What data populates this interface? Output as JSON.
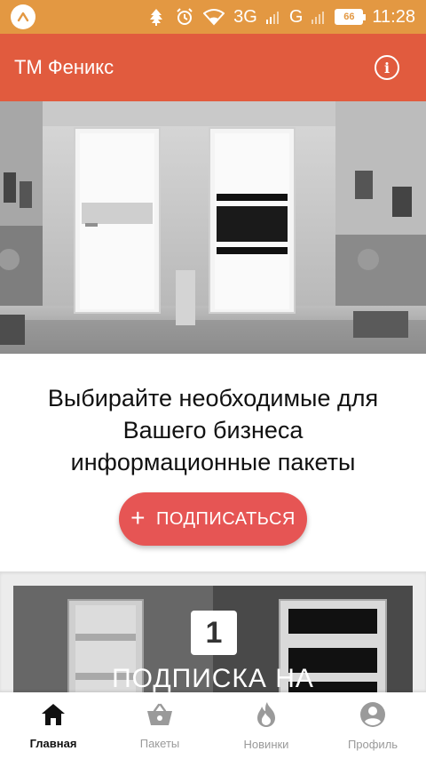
{
  "status_bar": {
    "network_3g": "3G",
    "network_g": "G",
    "battery": "66",
    "time": "11:28",
    "icons": [
      "app-badge-icon",
      "tree-icon",
      "alarm-icon",
      "wifi-icon",
      "signal-icon",
      "battery-icon"
    ]
  },
  "app_bar": {
    "title": "ТМ Феникс",
    "info_icon": "info-icon"
  },
  "intro": {
    "line1": "Выбирайте необходимые для",
    "line2": "Вашего бизнеса",
    "line3": "информационные пакеты",
    "subscribe_label": "ПОДПИСАТЬСЯ"
  },
  "card": {
    "number": "1",
    "title": "ПОДПИСКА НА"
  },
  "bottom_nav": {
    "items": [
      {
        "label": "Главная",
        "icon": "home-icon",
        "active": true
      },
      {
        "label": "Пакеты",
        "icon": "basket-icon",
        "active": false
      },
      {
        "label": "Новинки",
        "icon": "flame-icon",
        "active": false
      },
      {
        "label": "Профиль",
        "icon": "profile-icon",
        "active": false
      }
    ]
  },
  "colors": {
    "status_bar": "#E39842",
    "app_bar": "#E15B3E",
    "button": "#E65554"
  }
}
